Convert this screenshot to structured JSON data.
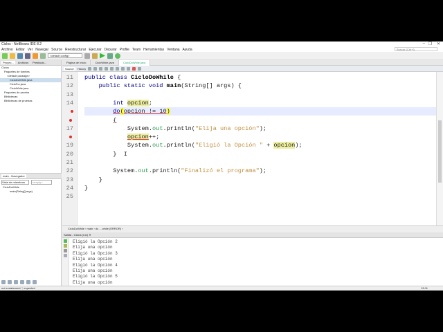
{
  "window": {
    "title": "Ciclos - NetBeans IDE 8.2",
    "search_placeholder": "Buscar (Ctrl+I)",
    "minimize": "–",
    "restore": "❐",
    "close": "✕"
  },
  "menu": [
    "Archivo",
    "Editar",
    "Ver",
    "Navegar",
    "Source",
    "Reestructurar",
    "Ejecutar",
    "Depurar",
    "Profile",
    "Team",
    "Herramientas",
    "Ventana",
    "Ayuda"
  ],
  "toolbar": {
    "config": "<default config>"
  },
  "projects": {
    "tabs": [
      "Proyec...",
      "Archivos",
      "Prestacio..."
    ],
    "tree": [
      "Ciclos",
      "Paquetes de fuentes",
      "<default package>",
      "CicloDoWhile.java",
      "CicloFor.java",
      "CicloWhile.java",
      "Paquetes de prueba",
      "Bibliotecas",
      "Bibliotecas de pruebas"
    ]
  },
  "navigator": {
    "tab": "main - Navegador",
    "view": "Vista de miembros",
    "filter": "<empty>",
    "items": [
      "CicloDoWhile",
      "main(String[] args)"
    ]
  },
  "editor": {
    "tabs": [
      "Página de Inicio",
      "CicloWhile.java",
      "CicloDoWhile.java"
    ],
    "source": "Source",
    "history": "History",
    "lines": [
      {
        "n": "11",
        "tok": [
          [
            "public class ",
            "k"
          ],
          [
            "CicloDoWhile",
            "b"
          ],
          [
            " {",
            ""
          ]
        ]
      },
      {
        "n": "12",
        "tok": [
          [
            "    public static void ",
            "k"
          ],
          [
            "main",
            "b"
          ],
          [
            "(String[] args) {",
            ""
          ]
        ]
      },
      {
        "n": "13",
        "tok": []
      },
      {
        "n": "14",
        "tok": [
          [
            "        int ",
            "k"
          ],
          [
            "opcion",
            "o"
          ],
          [
            ";",
            ""
          ]
        ]
      },
      {
        "n": "",
        "err": true,
        "hl": true,
        "tok": [
          [
            "        ",
            ""
          ],
          [
            "do",
            "k u"
          ],
          [
            "(",
            "y"
          ],
          [
            "opcion != 10",
            "u"
          ],
          [
            ")",
            "y"
          ]
        ]
      },
      {
        "n": "",
        "err": true,
        "tok": [
          [
            "        ",
            ""
          ],
          [
            "{",
            "u"
          ]
        ]
      },
      {
        "n": "17",
        "tok": [
          [
            "            System.",
            ""
          ],
          [
            "out",
            "f"
          ],
          [
            ".println(",
            ""
          ],
          [
            "\"Elija una opción\"",
            "s"
          ],
          [
            ");",
            ""
          ]
        ]
      },
      {
        "n": "",
        "err": true,
        "tok": [
          [
            "            ",
            ""
          ],
          [
            "opcion",
            "o u"
          ],
          [
            "++;",
            ""
          ]
        ]
      },
      {
        "n": "19",
        "tok": [
          [
            "            System.",
            ""
          ],
          [
            "out",
            "f"
          ],
          [
            ".println(",
            ""
          ],
          [
            "\"Eligió la Opción \"",
            "s"
          ],
          [
            " + ",
            ""
          ],
          [
            "opcion",
            "o"
          ],
          [
            ");",
            ""
          ]
        ]
      },
      {
        "n": "20",
        "tok": [
          [
            "        }  I",
            ""
          ]
        ]
      },
      {
        "n": "21",
        "tok": []
      },
      {
        "n": "22",
        "tok": [
          [
            "        System.",
            ""
          ],
          [
            "out",
            "f"
          ],
          [
            ".println(",
            ""
          ],
          [
            "\"Finalizó el programa\"",
            "s"
          ],
          [
            ");",
            ""
          ]
        ]
      },
      {
        "n": "23",
        "tok": [
          [
            "    }",
            ""
          ]
        ]
      },
      {
        "n": "24",
        "tok": [
          [
            "}",
            ""
          ]
        ]
      },
      {
        "n": "25",
        "tok": []
      }
    ]
  },
  "breadcrumb": "CicloDoWhile  ›  main  ›  do ... while (ERROR)  ›",
  "output": {
    "tab": "Salida - Ciclos (run)  ✕",
    "lines": [
      "Eligió la Opción 2",
      "Elija una opción",
      "Eligió la Opción 3",
      "Elija una opción",
      "Eligió la Opción 4",
      "Elija una opción",
      "Eligió la Opción 5",
      "Elija una opción"
    ]
  },
  "status": {
    "message": "not a statement  ';' expected",
    "position": "15:11"
  }
}
